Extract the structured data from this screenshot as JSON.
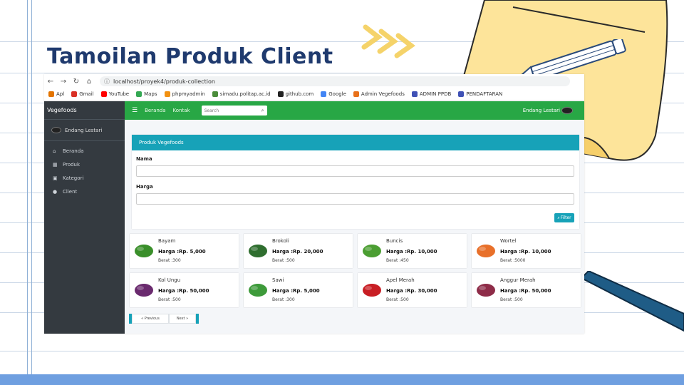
{
  "slide": {
    "title": "Tamoilan Produk Client"
  },
  "browser": {
    "url": "localhost/proyek4/produk-collection",
    "bookmarks": [
      {
        "label": "Apl",
        "color": "#e37400"
      },
      {
        "label": "Gmail",
        "color": "#d93025"
      },
      {
        "label": "YouTube",
        "color": "#ff0000"
      },
      {
        "label": "Maps",
        "color": "#34a853"
      },
      {
        "label": "phpmyadmin",
        "color": "#f29111"
      },
      {
        "label": "simadu.politap.ac.id",
        "color": "#4a8c3a"
      },
      {
        "label": "github.com",
        "color": "#222222"
      },
      {
        "label": "Google",
        "color": "#4285f4"
      },
      {
        "label": "Admin Vegefoods",
        "color": "#e8711a"
      },
      {
        "label": "ADMIN PPDB",
        "color": "#3f51b5"
      },
      {
        "label": "PENDAFTARAN",
        "color": "#3f51b5"
      }
    ]
  },
  "app": {
    "brand": "Vegefoods",
    "user": "Endang Lestari",
    "sidebar": [
      {
        "label": "Beranda",
        "icon": "home-icon"
      },
      {
        "label": "Produk",
        "icon": "calendar-icon"
      },
      {
        "label": "Kategori",
        "icon": "image-icon"
      },
      {
        "label": "Client",
        "icon": "user-icon"
      }
    ],
    "topnav": {
      "links": [
        "Beranda",
        "Kontak"
      ],
      "search_placeholder": "Search",
      "user": "Endang Lestari"
    },
    "filter": {
      "header": "Produk Vegefoods",
      "name_label": "Nama",
      "price_label": "Harga",
      "button": "Filter"
    },
    "products": [
      {
        "name": "Bayam",
        "price": "Harga :Rp. 5,000",
        "weight": "Berat :300",
        "color": "#3a8f2a"
      },
      {
        "name": "Brokoli",
        "price": "Harga :Rp. 20,000",
        "weight": "Berat :500",
        "color": "#2f6e2f"
      },
      {
        "name": "Buncis",
        "price": "Harga :Rp. 10,000",
        "weight": "Berat :450",
        "color": "#4b9e32"
      },
      {
        "name": "Wortel",
        "price": "Harga :Rp. 10,000",
        "weight": "Berat :5000",
        "color": "#e8702a"
      },
      {
        "name": "Kol Ungu",
        "price": "Harga :Rp. 50,000",
        "weight": "Berat :500",
        "color": "#6a2a6e"
      },
      {
        "name": "Sawi",
        "price": "Harga :Rp. 5,000",
        "weight": "Berat :300",
        "color": "#3d9a3a"
      },
      {
        "name": "Apel Merah",
        "price": "Harga :Rp. 30,000",
        "weight": "Berat :500",
        "color": "#c81e24"
      },
      {
        "name": "Anggur Merah",
        "price": "Harga :Rp. 50,000",
        "weight": "Berat :500",
        "color": "#8e2c48"
      }
    ],
    "pagination": {
      "prev": "« Previous",
      "next": "Next »"
    }
  }
}
